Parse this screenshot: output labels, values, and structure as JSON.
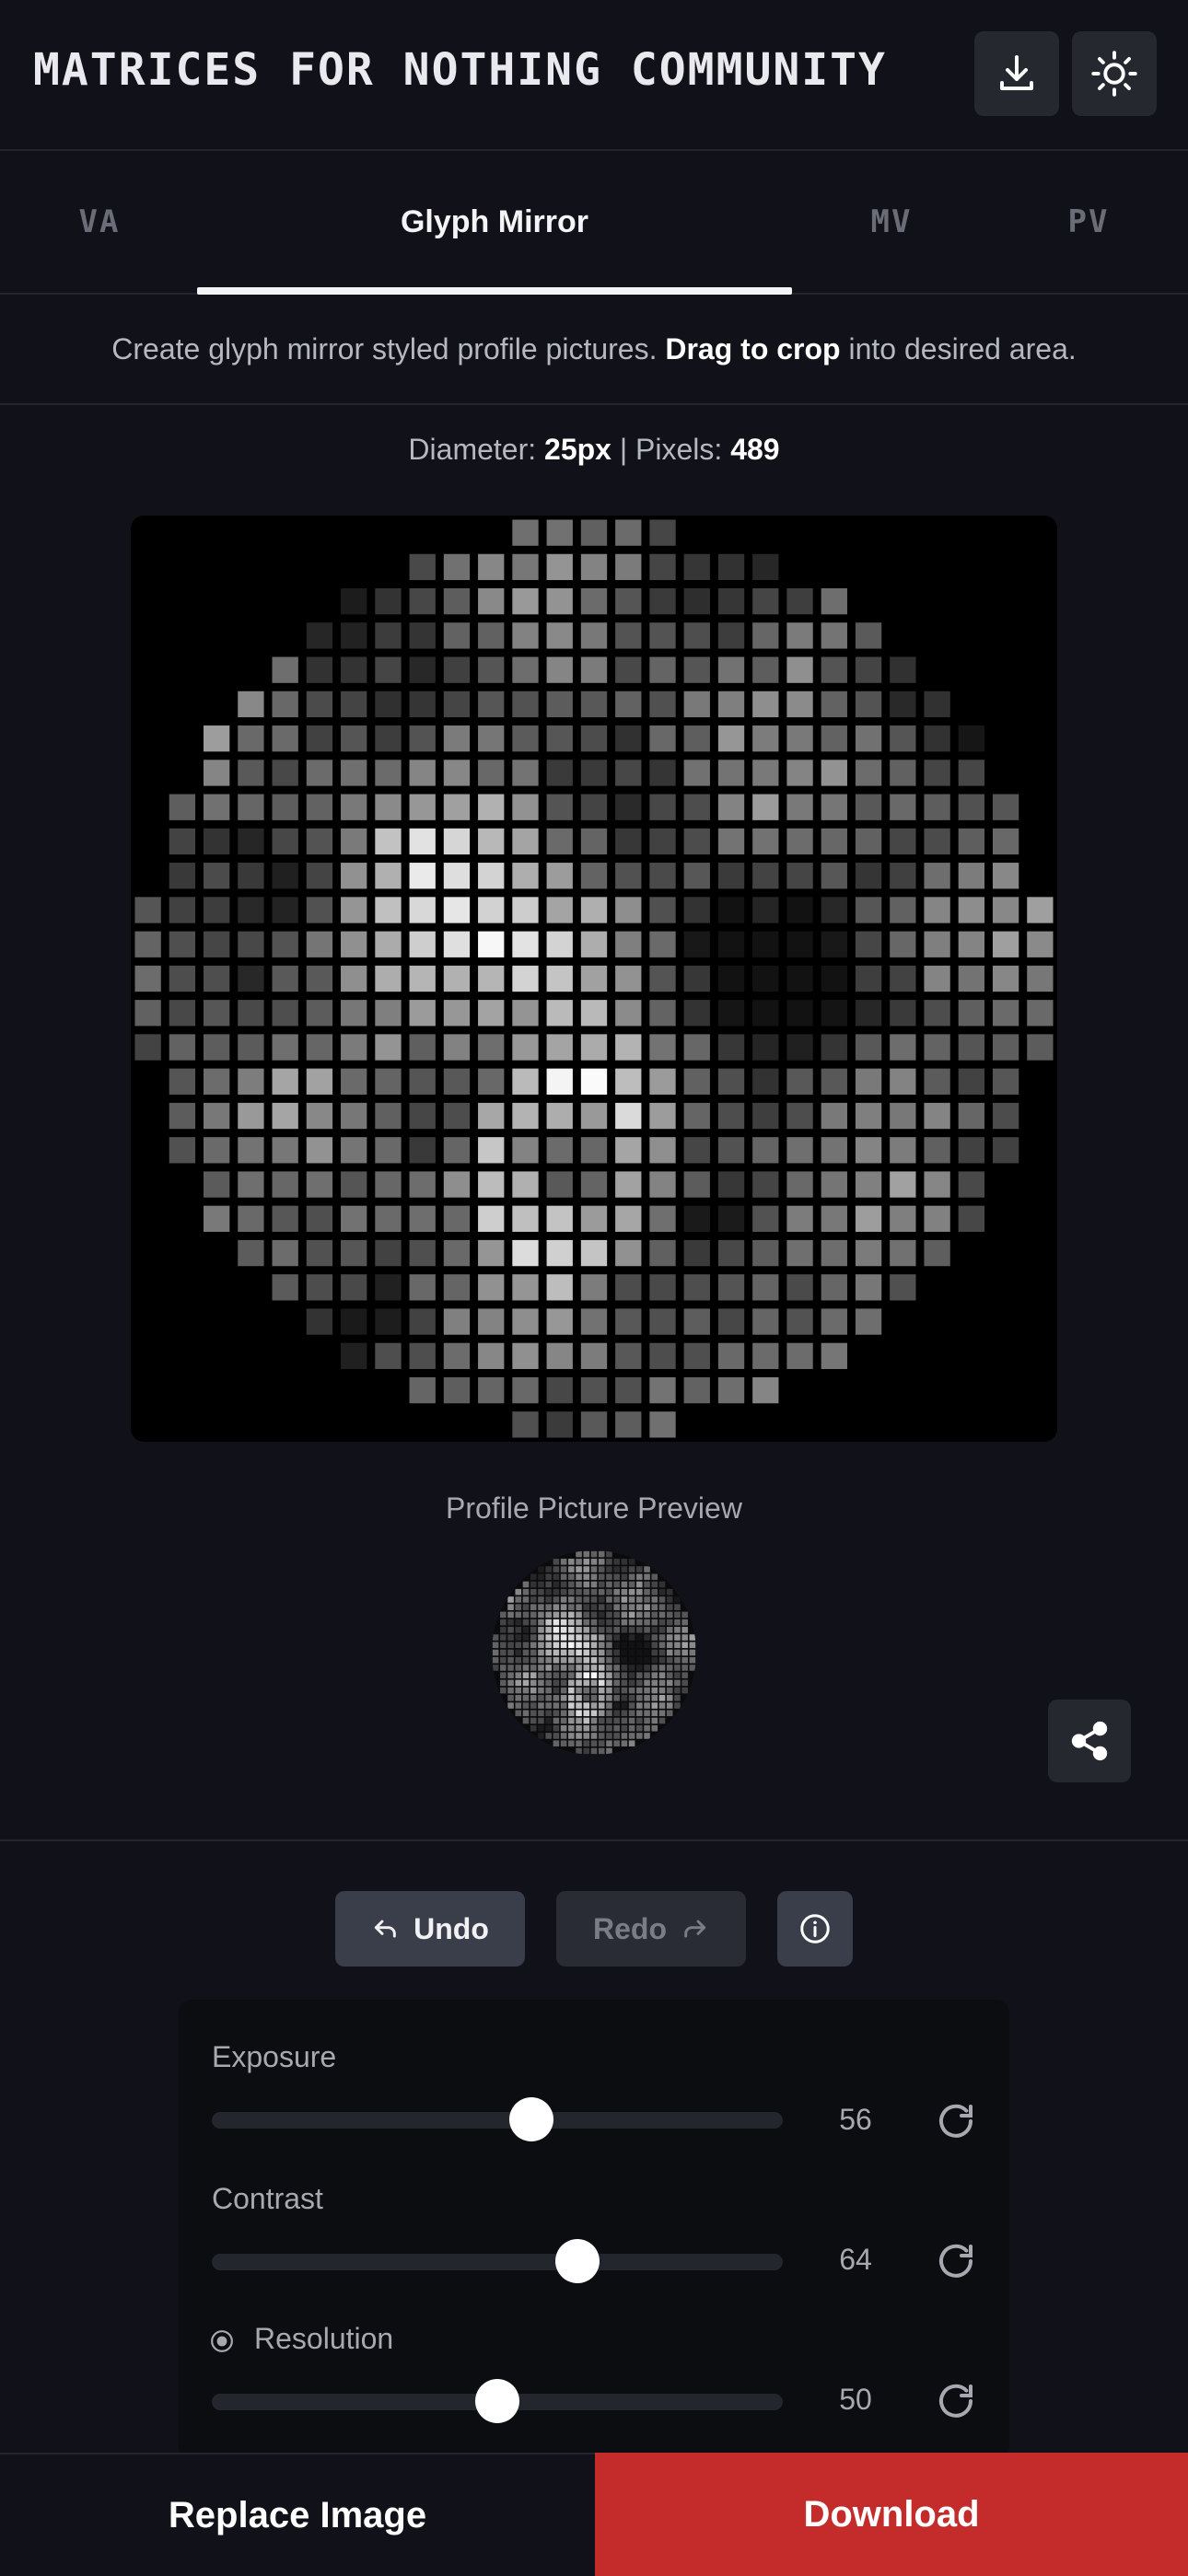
{
  "header": {
    "title": "MATRICES FOR NOTHING COMMUNITY",
    "download_icon": "download-icon",
    "theme_icon": "sun-icon"
  },
  "tabs": [
    {
      "label": "VA"
    },
    {
      "label": "Glyph Mirror"
    },
    {
      "label": "MV"
    },
    {
      "label": "PV"
    }
  ],
  "description": {
    "before": "Create glyph mirror styled profile pictures. ",
    "bold": "Drag to crop",
    "after": " into desired area."
  },
  "stats": {
    "diameter_label": "Diameter: ",
    "diameter_value": "25px",
    "separator": " | ",
    "pixels_label": "Pixels: ",
    "pixels_value": "489"
  },
  "preview": {
    "label": "Profile Picture Preview",
    "share_icon": "share-icon"
  },
  "history": {
    "undo_label": "Undo",
    "redo_label": "Redo",
    "info_icon": "info-icon"
  },
  "controls": {
    "exposure": {
      "label": "Exposure",
      "value": "56",
      "percent": 56
    },
    "contrast": {
      "label": "Contrast",
      "value": "64",
      "percent": 64
    },
    "resolution": {
      "label": "Resolution",
      "value": "50",
      "percent": 50
    }
  },
  "footer": {
    "replace_label": "Replace Image",
    "download_label": "Download",
    "accent": "#c42c2c"
  }
}
